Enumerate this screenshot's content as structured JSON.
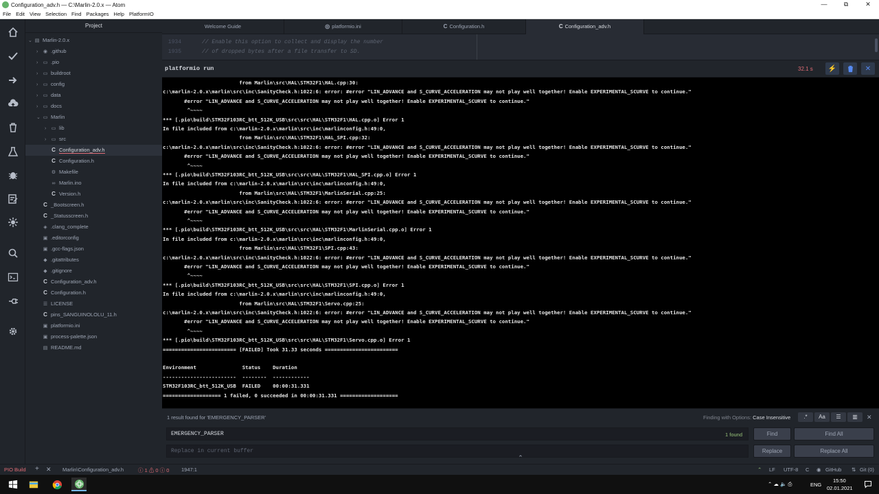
{
  "window": {
    "title": "Configuration_adv.h — C:\\Marlin-2.0.x — Atom",
    "minimize": "—",
    "maximize": "⧉",
    "close": "✕"
  },
  "menu": [
    "File",
    "Edit",
    "View",
    "Selection",
    "Find",
    "Packages",
    "Help",
    "PlatformIO"
  ],
  "tree": {
    "header": "Project",
    "items": [
      {
        "label": "Marlin-2.0.x",
        "arrow": "⌄",
        "icon": "▤"
      },
      {
        "label": ".github",
        "arrow": "›",
        "icon": "◉"
      },
      {
        "label": ".pio",
        "arrow": "›",
        "icon": "▭"
      },
      {
        "label": "buildroot",
        "arrow": "›",
        "icon": "▭"
      },
      {
        "label": "config",
        "arrow": "›",
        "icon": "▭"
      },
      {
        "label": "data",
        "arrow": "›",
        "icon": "▭"
      },
      {
        "label": "docs",
        "arrow": "›",
        "icon": "▭"
      },
      {
        "label": "Marlin",
        "arrow": "⌄",
        "icon": "▭"
      },
      {
        "label": "lib",
        "arrow": "›",
        "icon": "▭"
      },
      {
        "label": "src",
        "arrow": "›",
        "icon": "▭"
      },
      {
        "label": "Configuration_adv.h",
        "arrow": "",
        "icon": "C"
      },
      {
        "label": "Configuration.h",
        "arrow": "",
        "icon": "C"
      },
      {
        "label": "Makefile",
        "arrow": "",
        "icon": "⚙"
      },
      {
        "label": "Marlin.ino",
        "arrow": "",
        "icon": "∞"
      },
      {
        "label": "Version.h",
        "arrow": "",
        "icon": "C"
      },
      {
        "label": "_Bootscreen.h",
        "arrow": "",
        "icon": "C"
      },
      {
        "label": "_Statusscreen.h",
        "arrow": "",
        "icon": "C"
      },
      {
        "label": ".clang_complete",
        "arrow": "",
        "icon": "◈"
      },
      {
        "label": ".editorconfig",
        "arrow": "",
        "icon": "▣"
      },
      {
        "label": ".gcc-flags.json",
        "arrow": "",
        "icon": "▣"
      },
      {
        "label": ".gitattributes",
        "arrow": "",
        "icon": "◆"
      },
      {
        "label": ".gitignore",
        "arrow": "",
        "icon": "◆"
      },
      {
        "label": "Configuration_adv.h",
        "arrow": "",
        "icon": "C"
      },
      {
        "label": "Configuration.h",
        "arrow": "",
        "icon": "C"
      },
      {
        "label": "LICENSE",
        "arrow": "",
        "icon": "☰"
      },
      {
        "label": "pins_SANGUINOLOLU_11.h",
        "arrow": "",
        "icon": "C"
      },
      {
        "label": "platformio.ini",
        "arrow": "",
        "icon": "▣"
      },
      {
        "label": "process-palette.json",
        "arrow": "",
        "icon": "▣"
      },
      {
        "label": "README.md",
        "arrow": "",
        "icon": "▤"
      }
    ]
  },
  "tabs": [
    {
      "label": "Welcome Guide",
      "icon": ""
    },
    {
      "label": "platformio.ini",
      "icon": "◎"
    },
    {
      "label": "Configuration.h",
      "icon": "C"
    },
    {
      "label": "Configuration_adv.h",
      "icon": "C"
    }
  ],
  "editor": {
    "lines": [
      {
        "num": "1934",
        "text": "// Enable this option to collect and display the number"
      },
      {
        "num": "1935",
        "text": "// of dropped bytes after a file transfer to SD."
      }
    ]
  },
  "panel": {
    "title": "platformio run",
    "time": "32.1 s",
    "icon_run": "⚡",
    "icon_trash": "🗑",
    "icon_close": "✕"
  },
  "terminal": {
    "lines": [
      "                         from Marlin\\src\\HAL\\STM32F1\\HAL.cpp:30:",
      "c:\\marlin-2.0.x\\marlin\\src\\inc\\SanityCheck.h:1022:6: error: #error \"LIN_ADVANCE and S_CURVE_ACCELERATION may not play well together! Enable EXPERIMENTAL_SCURVE to continue.\"",
      "       #error \"LIN_ADVANCE and S_CURVE_ACCELERATION may not play well together! Enable EXPERIMENTAL_SCURVE to continue.\"",
      "        ^~~~~",
      "*** [.pio\\build\\STM32F103RC_btt_512K_USB\\src\\src\\HAL\\STM32F1\\HAL.cpp.o] Error 1",
      "In file included from c:\\marlin-2.0.x\\marlin\\src\\inc\\marlinconfig.h:49:0,",
      "                         from Marlin\\src\\HAL\\STM32F1\\HAL_SPI.cpp:32:",
      "c:\\marlin-2.0.x\\marlin\\src\\inc\\SanityCheck.h:1022:6: error: #error \"LIN_ADVANCE and S_CURVE_ACCELERATION may not play well together! Enable EXPERIMENTAL_SCURVE to continue.\"",
      "       #error \"LIN_ADVANCE and S_CURVE_ACCELERATION may not play well together! Enable EXPERIMENTAL_SCURVE to continue.\"",
      "        ^~~~~",
      "*** [.pio\\build\\STM32F103RC_btt_512K_USB\\src\\src\\HAL\\STM32F1\\HAL_SPI.cpp.o] Error 1",
      "In file included from c:\\marlin-2.0.x\\marlin\\src\\inc\\marlinconfig.h:49:0,",
      "                         from Marlin\\src\\HAL\\STM32F1\\MarlinSerial.cpp:25:",
      "c:\\marlin-2.0.x\\marlin\\src\\inc\\SanityCheck.h:1022:6: error: #error \"LIN_ADVANCE and S_CURVE_ACCELERATION may not play well together! Enable EXPERIMENTAL_SCURVE to continue.\"",
      "       #error \"LIN_ADVANCE and S_CURVE_ACCELERATION may not play well together! Enable EXPERIMENTAL_SCURVE to continue.\"",
      "        ^~~~~",
      "*** [.pio\\build\\STM32F103RC_btt_512K_USB\\src\\src\\HAL\\STM32F1\\MarlinSerial.cpp.o] Error 1",
      "In file included from c:\\marlin-2.0.x\\marlin\\src\\inc\\marlinconfig.h:49:0,",
      "                         from Marlin\\src\\HAL\\STM32F1\\SPI.cpp:43:",
      "c:\\marlin-2.0.x\\marlin\\src\\inc\\SanityCheck.h:1022:6: error: #error \"LIN_ADVANCE and S_CURVE_ACCELERATION may not play well together! Enable EXPERIMENTAL_SCURVE to continue.\"",
      "       #error \"LIN_ADVANCE and S_CURVE_ACCELERATION may not play well together! Enable EXPERIMENTAL_SCURVE to continue.\"",
      "        ^~~~~",
      "*** [.pio\\build\\STM32F103RC_btt_512K_USB\\src\\src\\HAL\\STM32F1\\SPI.cpp.o] Error 1",
      "In file included from c:\\marlin-2.0.x\\marlin\\src\\inc\\marlinconfig.h:49:0,",
      "                         from Marlin\\src\\HAL\\STM32F1\\Servo.cpp:25:",
      "c:\\marlin-2.0.x\\marlin\\src\\inc\\SanityCheck.h:1022:6: error: #error \"LIN_ADVANCE and S_CURVE_ACCELERATION may not play well together! Enable EXPERIMENTAL_SCURVE to continue.\"",
      "       #error \"LIN_ADVANCE and S_CURVE_ACCELERATION may not play well together! Enable EXPERIMENTAL_SCURVE to continue.\"",
      "        ^~~~~",
      "*** [.pio\\build\\STM32F103RC_btt_512K_USB\\src\\src\\HAL\\STM32F1\\Servo.cpp.o] Error 1",
      "======================== [FAILED] Took 31.33 seconds ========================",
      "",
      "Environment               Status    Duration",
      "------------------------  --------  ------------",
      "STM32F103RC_btt_512K_USB  FAILED    00:00:31.331",
      "=================== 1 failed, 0 succeeded in 00:00:31.331 ==================="
    ]
  },
  "find": {
    "result_info": "1 result found for 'EMERGENCY_PARSER'",
    "options_prefix": "Finding with Options:",
    "options_value": "Case Insensitive",
    "opt_buttons": [
      ".*",
      "Aa",
      "☰",
      "▥"
    ],
    "close": "✕",
    "find_value": "EMERGENCY_PARSER",
    "found_count": "1 found",
    "replace_placeholder": "Replace in current buffer",
    "find_label": "Find",
    "find_all_label": "Find All",
    "replace_label": "Replace",
    "replace_all_label": "Replace All",
    "chevron": "⌃"
  },
  "status": {
    "pio_build": "PIO Build",
    "plus": "+",
    "x": "✕",
    "file_path": "Marlin\\Configuration_adv.h",
    "errors": "ⓘ 1 ⚠ 0 ⓘ 0",
    "cursor": "1947:1",
    "up_icon": "⌃",
    "line_ending": "LF",
    "encoding": "UTF-8",
    "grammar": "C",
    "github": "GitHub",
    "git": "Git (0)"
  },
  "taskbar": {
    "lang": "ENG",
    "time": "15:50",
    "date": "02.01.2021",
    "tray_icons": "⌃  ☁  🔈  ⎙"
  }
}
